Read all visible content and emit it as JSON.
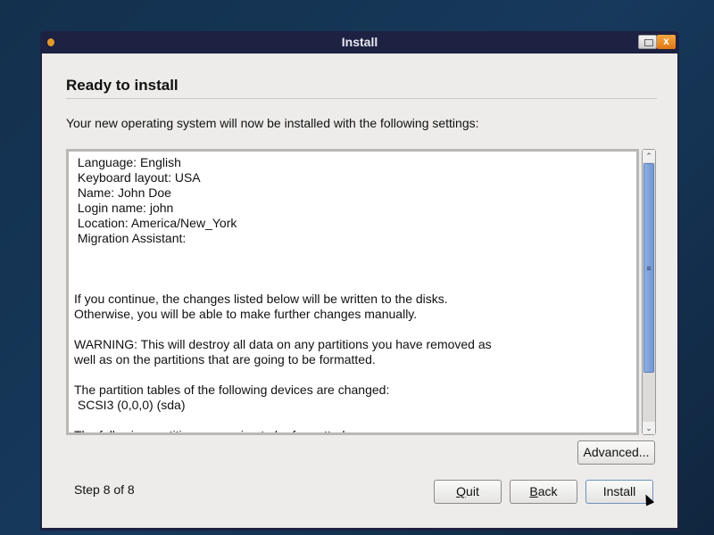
{
  "window": {
    "title": "Install",
    "close_glyph": "x"
  },
  "page": {
    "heading": "Ready to install",
    "intro": "Your new operating system will now be installed with the following settings:"
  },
  "summary_lines": [
    " Language: English",
    " Keyboard layout: USA",
    " Name: John Doe",
    " Login name: john",
    " Location: America/New_York",
    " Migration Assistant:",
    "",
    "",
    "",
    "If you continue, the changes listed below will be written to the disks.",
    "Otherwise, you will be able to make further changes manually.",
    "",
    "WARNING: This will destroy all data on any partitions you have removed as",
    "well as on the partitions that are going to be formatted.",
    "",
    "The partition tables of the following devices are changed:",
    " SCSI3 (0,0,0) (sda)",
    "",
    "The following partitions are going to be formatted:"
  ],
  "buttons": {
    "advanced": "Advanced...",
    "quit": "Quit",
    "back": "Back",
    "install": "Install"
  },
  "footer": {
    "step": "Step 8 of 8"
  },
  "scroll_position": 0
}
